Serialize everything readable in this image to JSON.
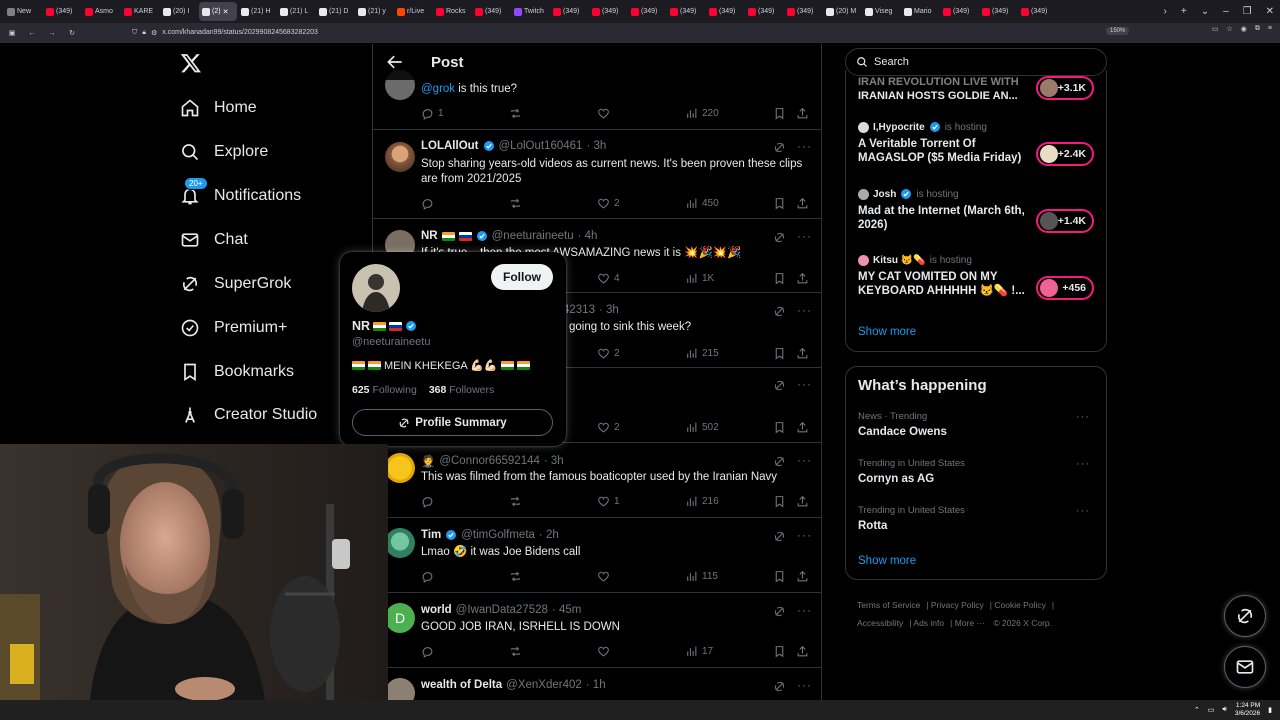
{
  "browser": {
    "tabs": [
      {
        "label": "New",
        "color": "#7f7f8a"
      },
      {
        "label": "(349)",
        "color": "#ff0033"
      },
      {
        "label": "Asmo",
        "color": "#ff0033"
      },
      {
        "label": "KARE",
        "color": "#ff0033"
      },
      {
        "label": "(20) I",
        "color": "#e7e9ea"
      },
      {
        "label": "(2)",
        "color": "#e7e9ea",
        "active": true
      },
      {
        "label": "(21) H",
        "color": "#e7e9ea"
      },
      {
        "label": "(21) L",
        "color": "#e7e9ea"
      },
      {
        "label": "(21) D",
        "color": "#e7e9ea"
      },
      {
        "label": "(21) y",
        "color": "#e7e9ea"
      },
      {
        "label": "r/Live",
        "color": "#ff4500"
      },
      {
        "label": "Rocks",
        "color": "#ff0033"
      },
      {
        "label": "(349)",
        "color": "#ff0033"
      },
      {
        "label": "Twitch",
        "color": "#9146ff"
      },
      {
        "label": "(349)",
        "color": "#ff0033"
      },
      {
        "label": "(349)",
        "color": "#ff0033"
      },
      {
        "label": "(349)",
        "color": "#ff0033"
      },
      {
        "label": "(349)",
        "color": "#ff0033"
      },
      {
        "label": "(349)",
        "color": "#ff0033"
      },
      {
        "label": "(349)",
        "color": "#ff0033"
      },
      {
        "label": "(349)",
        "color": "#ff0033"
      },
      {
        "label": "(20) M",
        "color": "#e7e9ea"
      },
      {
        "label": "Viseg",
        "color": "#e7e9ea"
      },
      {
        "label": "Mario",
        "color": "#e7e9ea"
      },
      {
        "label": "(349)",
        "color": "#ff0033"
      },
      {
        "label": "(349)",
        "color": "#ff0033"
      },
      {
        "label": "(349)",
        "color": "#ff0033"
      }
    ],
    "url": "x.com/khanadan99/status/2029908245683282203",
    "zoom": "150%"
  },
  "nav": {
    "home": "Home",
    "explore": "Explore",
    "notifications": "Notifications",
    "notifications_badge": "20+",
    "chat": "Chat",
    "supergrok": "SuperGrok",
    "premium": "Premium+",
    "bookmarks": "Bookmarks",
    "creator_studio": "Creator Studio"
  },
  "header": {
    "title": "Post"
  },
  "tweets": [
    {
      "text_mention": "@grok",
      "text": " is this true?",
      "replies": "1",
      "retweets": "",
      "likes": "",
      "views": "220"
    },
    {
      "name": "LOLAllOut",
      "handle": "@LolOut160461",
      "time": "· 3h",
      "text": "Stop sharing years-old videos as current news. It's been proven these clips are from 2021/2025",
      "replies": "",
      "retweets": "",
      "likes": "2",
      "views": "450"
    },
    {
      "name": "NR",
      "handle": "@neeturaineetu",
      "time": "· 4h",
      "text": "If it's true... then the most AWSAMAZING news it is 💥🎉💥🎉",
      "replies": "",
      "retweets": "",
      "likes": "4",
      "views": "1K"
    },
    {
      "handle": "42313",
      "time": "· 3h",
      "text": "going to sink this week?",
      "likes": "2",
      "views": "215"
    },
    {
      "likes": "2",
      "views": "502"
    },
    {
      "handle": "@Connor66592144",
      "time": "· 3h",
      "text": "This was filmed from the famous boaticopter used by the Iranian Navy",
      "likes": "1",
      "views": "216"
    },
    {
      "name": "Tim",
      "handle": "@timGolfmeta",
      "time": "· 2h",
      "text": "Lmao 🤣 it was Joe Bidens call",
      "views": "115"
    },
    {
      "name": "world",
      "handle": "@IwanData27528",
      "time": "· 45m",
      "text": "GOOD JOB IRAN, ISRHELL IS DOWN",
      "views": "17"
    },
    {
      "name": "wealth of Delta",
      "handle": "@XenXder402",
      "time": "· 1h"
    }
  ],
  "hovercard": {
    "name": "NR",
    "handle": "@neeturaineetu",
    "bio": "MEIN KHEKEGA 💪🏻💪🏻",
    "following_count": "625",
    "following_label": "Following",
    "followers_count": "368",
    "followers_label": "Followers",
    "follow_label": "Follow",
    "summary_label": "Profile Summary"
  },
  "search": {
    "placeholder": "Search"
  },
  "spaces": [
    {
      "title": "IRANIAN HOSTS GOLDIE AN...",
      "title_top": "IRAN REVOLUTION LIVE WITH",
      "count": "+3.1K"
    },
    {
      "host": "I,Hypocrite",
      "status": "is hosting",
      "title": "A Veritable Torrent Of MAGASLOP ($5 Media Friday)",
      "count": "+2.4K"
    },
    {
      "host": "Josh",
      "status": "is hosting",
      "title": "Mad at the Internet (March 6th, 2026)",
      "count": "+1.4K"
    },
    {
      "host": "Kitsu 😾💊",
      "status": "is hosting",
      "title": "MY CAT VOMITED ON MY KEYBOARD AHHHHH 😾💊 !...",
      "count": "+456"
    }
  ],
  "spaces_show_more": "Show more",
  "happening": {
    "title": "What’s happening",
    "trends": [
      {
        "meta": "News · Trending",
        "name": "Candace Owens"
      },
      {
        "meta": "Trending in United States",
        "name": "Cornyn as AG"
      },
      {
        "meta": "Trending in United States",
        "name": "Rotta"
      }
    ],
    "show_more": "Show more"
  },
  "footer": {
    "terms": "Terms of Service",
    "privacy": "Privacy Policy",
    "cookie": "Cookie Policy",
    "accessibility": "Accessibility",
    "ads": "Ads info",
    "more": "More ···",
    "copyright": "© 2026 X Corp."
  },
  "taskbar": {
    "time": "1:24 PM",
    "date": "3/6/2026"
  },
  "colors": {
    "accent": "#1d9bf0",
    "live": "#f91880",
    "bg": "#000000",
    "border": "#2f3336",
    "muted": "#71767b"
  }
}
